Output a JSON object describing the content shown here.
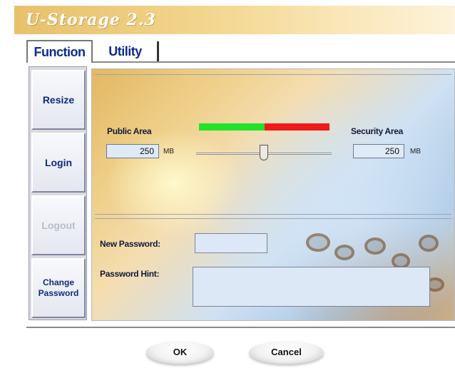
{
  "window": {
    "title": "U-Storage 2.3"
  },
  "tabs": [
    {
      "label": "Function",
      "active": true
    },
    {
      "label": "Utility",
      "active": false
    }
  ],
  "sidebar": {
    "items": [
      {
        "label": "Resize",
        "enabled": true
      },
      {
        "label": "Login",
        "enabled": true
      },
      {
        "label": "Logout",
        "enabled": false
      },
      {
        "label": "Change Password",
        "enabled": true
      }
    ]
  },
  "partition": {
    "public_label": "Public Area",
    "public_value": "250",
    "public_unit": "MB",
    "security_label": "Security Area",
    "security_value": "250",
    "security_unit": "MB",
    "public_fraction": 0.5,
    "public_color": "#22e22a",
    "security_color": "#ee1b1b"
  },
  "password": {
    "new_label": "New Password:",
    "new_value": "",
    "hint_label": "Password Hint:",
    "hint_value": ""
  },
  "buttons": {
    "ok_label": "OK",
    "cancel_label": "Cancel"
  }
}
